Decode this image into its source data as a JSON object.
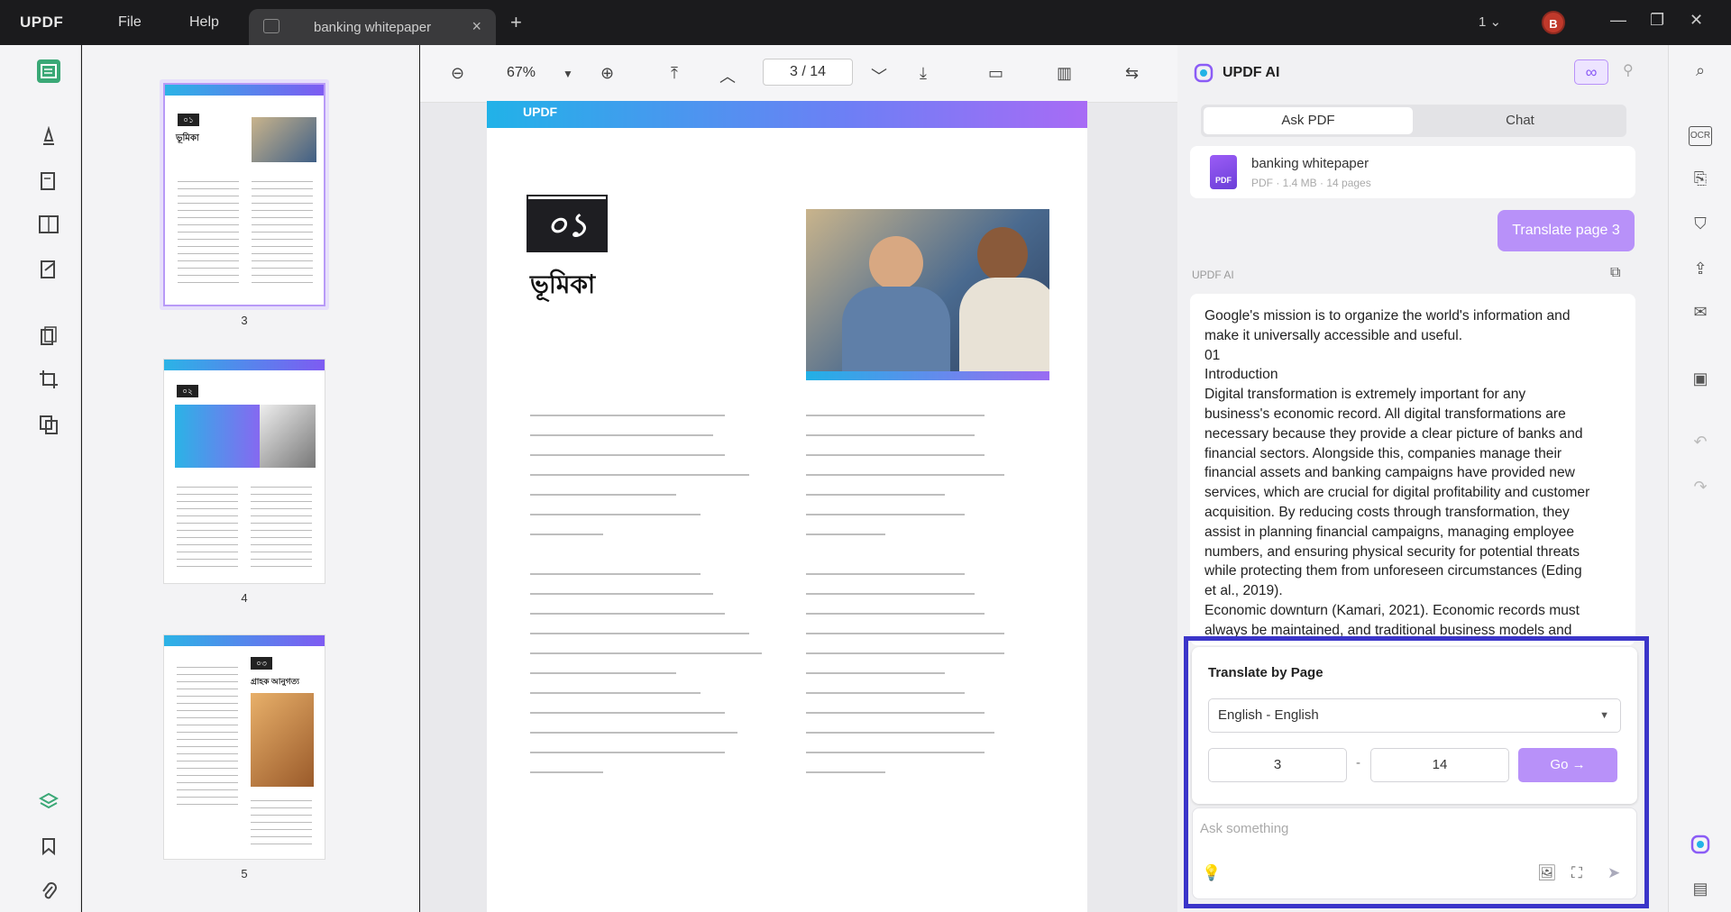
{
  "app": {
    "logo": "UPDF",
    "menu_file": "File",
    "menu_help": "Help",
    "tab_title": "banking whitepaper",
    "page_count_indicator": "1",
    "avatar_initial": "B"
  },
  "viewer": {
    "zoom": "67%",
    "current_page": "3",
    "page_separator": "/",
    "total_pages": "14"
  },
  "thumbnails": [
    {
      "label": "3",
      "title": "ভূমিকা",
      "num": "০১"
    },
    {
      "label": "4",
      "title": "",
      "num": "০২"
    },
    {
      "label": "5",
      "title": "গ্রাহক আনুগত্য",
      "num": "০৩"
    }
  ],
  "page": {
    "header_brand": "UPDF",
    "chapter_number": "০১",
    "title": "ভূমিকা"
  },
  "ai_panel": {
    "title": "UPDF AI",
    "tab_ask": "Ask PDF",
    "tab_chat": "Chat",
    "file_name": "banking whitepaper",
    "file_meta": "PDF · 1.4 MB · 14 pages",
    "pdf_icon_text": "PDF",
    "user_message": "Translate page 3",
    "response_label": "UPDF AI",
    "response_text": "Google's mission is to organize the world's information and\nmake it universally accessible and useful.\n01\nIntroduction\nDigital transformation is extremely important for any\nbusiness's economic record. All digital transformations are\nnecessary because they provide a clear picture of banks and\nfinancial sectors. Alongside this, companies manage their\nfinancial assets and banking campaigns have provided new\nservices, which are crucial for digital profitability and customer\nacquisition. By reducing costs through transformation, they\nassist in planning financial campaigns, managing employee\nnumbers, and ensuring physical security for potential threats\nwhile protecting them from unforeseen circumstances (Eding\net al., 2019).\nEconomic downturn (Kamari, 2021). Economic records must\nalways be maintained, and traditional business models and",
    "translate_title": "Translate by Page",
    "language": "English - English",
    "from_page": "3",
    "page_range_separator": "-",
    "to_page": "14",
    "go_label": "Go →",
    "ask_placeholder": "Ask something"
  },
  "colors": {
    "accent": "#b891f9",
    "highlight_border": "#3b35c9",
    "header_gradient_start": "#21b2e8",
    "header_gradient_end": "#a86bf5"
  },
  "icons": {
    "left_toolbar": [
      "reader-icon",
      "comment-icon",
      "edit-icon",
      "organize-icon",
      "form-icon",
      "page-tools-icon",
      "crop-icon",
      "compare-icon",
      "layers-icon",
      "bookmark-icon",
      "attachment-icon"
    ],
    "right_toolbar": [
      "search-icon",
      "ocr-icon",
      "convert-icon",
      "protect-icon",
      "share-icon",
      "email-icon",
      "save-icon",
      "undo-icon",
      "redo-icon",
      "ai-icon",
      "comment-list-icon"
    ]
  }
}
